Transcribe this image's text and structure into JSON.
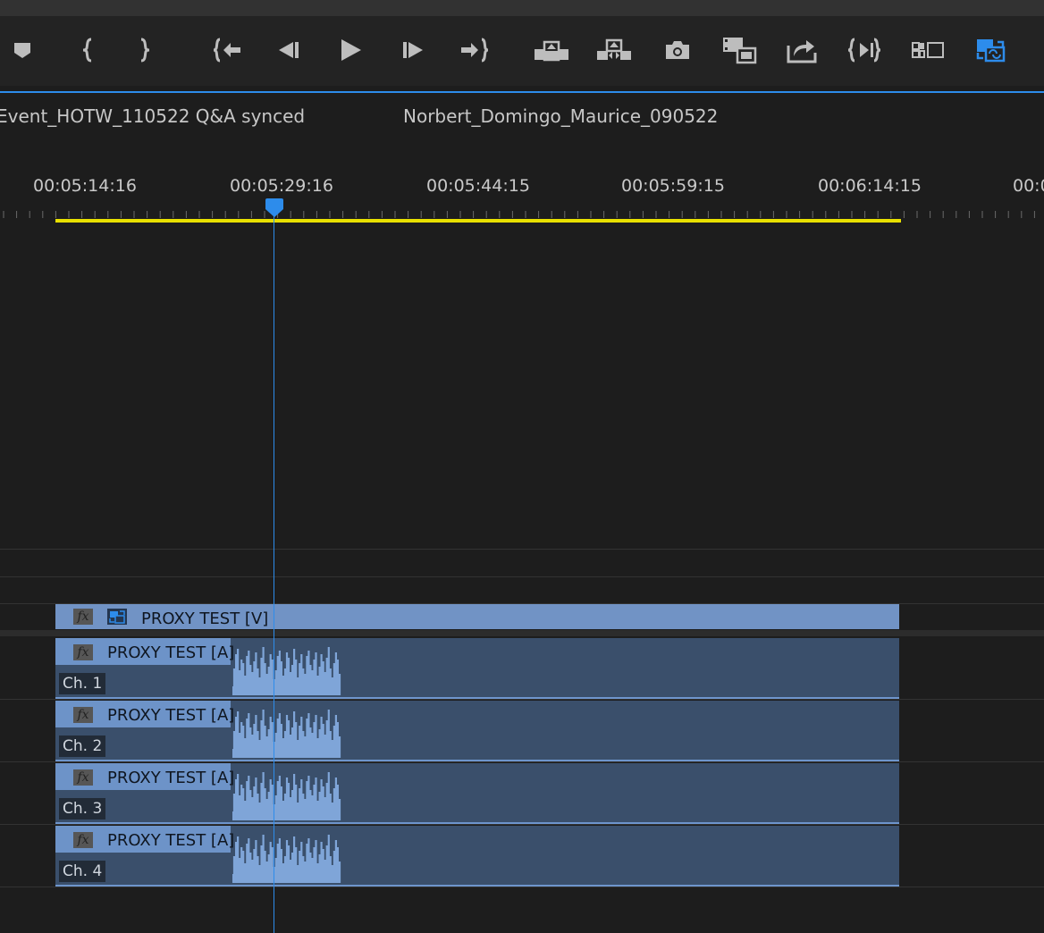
{
  "transport": {
    "buttons": [
      {
        "name": "add-marker-button",
        "icon": "marker-icon"
      },
      {
        "name": "mark-in-button",
        "icon": "mark-in-icon"
      },
      {
        "name": "mark-out-button",
        "icon": "mark-out-icon"
      },
      {
        "name": "go-to-in-button",
        "icon": "go-to-in-icon"
      },
      {
        "name": "step-back-button",
        "icon": "step-back-icon"
      },
      {
        "name": "play-button",
        "icon": "play-icon"
      },
      {
        "name": "step-forward-button",
        "icon": "step-forward-icon"
      },
      {
        "name": "go-to-out-button",
        "icon": "go-to-out-icon"
      },
      {
        "name": "lift-button",
        "icon": "lift-icon"
      },
      {
        "name": "extract-button",
        "icon": "extract-icon"
      },
      {
        "name": "export-frame-button",
        "icon": "camera-icon"
      },
      {
        "name": "insert-button",
        "icon": "insert-icon"
      },
      {
        "name": "overwrite-button",
        "icon": "overwrite-icon"
      },
      {
        "name": "trim-button",
        "icon": "trim-icon"
      },
      {
        "name": "multi-camera-button",
        "icon": "multicam-icon"
      },
      {
        "name": "toggle-proxies-button",
        "icon": "proxy-toggle-icon"
      }
    ],
    "accent_color": "#2d8ceb"
  },
  "tabs": [
    {
      "label": "Event_HOTW_110522 Q&A synced"
    },
    {
      "label": "Norbert_Domingo_Maurice_090522"
    }
  ],
  "ruler": {
    "timecodes": [
      "00:05:14:16",
      "00:05:29:16",
      "00:05:44:15",
      "00:05:59:15",
      "00:06:14:15",
      "00:0"
    ],
    "inout_color": "#e8e000",
    "playhead_color": "#2d8ceb"
  },
  "tracks": {
    "video_clip": {
      "fx": "fx",
      "title": "PROXY TEST [V]"
    },
    "audio_clips": [
      {
        "fx": "fx",
        "title": "PROXY TEST [A]",
        "channel": "Ch. 1"
      },
      {
        "fx": "fx",
        "title": "PROXY TEST [A]",
        "channel": "Ch. 2"
      },
      {
        "fx": "fx",
        "title": "PROXY TEST [A]",
        "channel": "Ch. 3"
      },
      {
        "fx": "fx",
        "title": "PROXY TEST [A]",
        "channel": "Ch. 4"
      }
    ],
    "clip_video_color": "#7193c5",
    "clip_audio_color": "#3a4f6b"
  }
}
